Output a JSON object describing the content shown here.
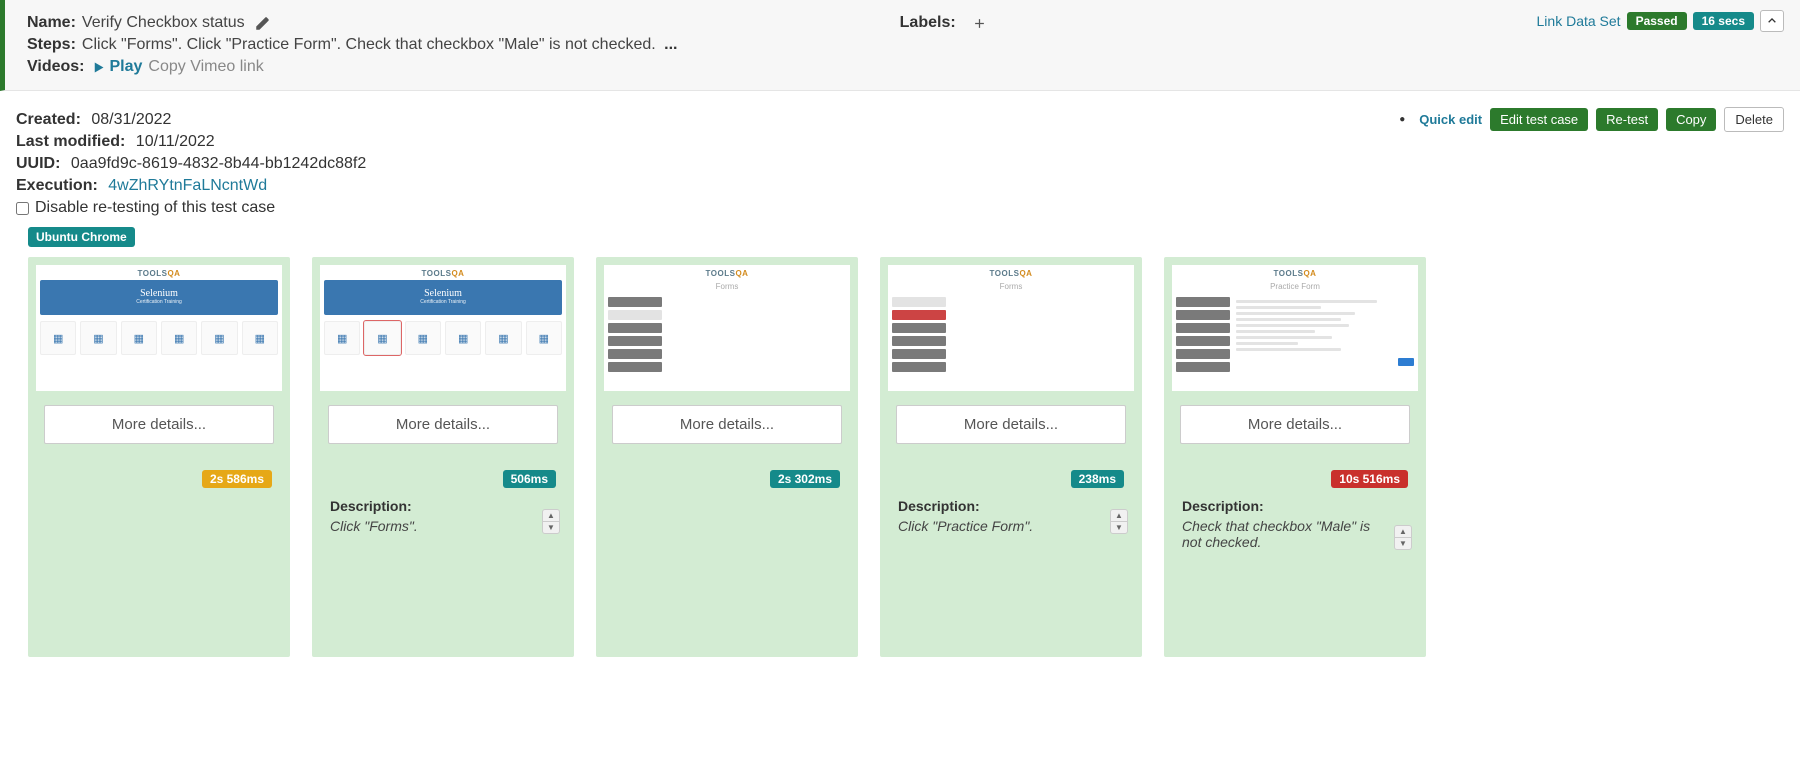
{
  "header": {
    "name_label": "Name:",
    "name_value": "Verify Checkbox status",
    "labels_label": "Labels:",
    "steps_label": "Steps:",
    "steps_value": "Click \"Forms\". Click \"Practice Form\". Check that checkbox \"Male\" is not checked.",
    "videos_label": "Videos:",
    "play_label": "Play",
    "copy_vimeo_label": "Copy Vimeo link",
    "link_dataset": "Link Data Set",
    "status_badge": "Passed",
    "duration_badge": "16 secs"
  },
  "meta": {
    "created_label": "Created:",
    "created_value": "08/31/2022",
    "modified_label": "Last modified:",
    "modified_value": "10/11/2022",
    "uuid_label": "UUID:",
    "uuid_value": "0aa9fd9c-8619-4832-8b44-bb1242dc88f2",
    "execution_label": "Execution:",
    "execution_value": "4wZhRYtnFaLNcntWd",
    "disable_label": "Disable re-testing of this test case",
    "quick_edit": "Quick edit",
    "edit_btn": "Edit test case",
    "retest_btn": "Re-test",
    "copy_btn": "Copy",
    "delete_btn": "Delete"
  },
  "env_tag": "Ubuntu Chrome",
  "cards": [
    {
      "more": "More details...",
      "time": "2s 586ms",
      "time_class": "t-orange",
      "desc_label": "",
      "desc_text": "",
      "thumb": "home"
    },
    {
      "more": "More details...",
      "time": "506ms",
      "time_class": "t-teal",
      "desc_label": "Description:",
      "desc_text": "Click \"Forms\".",
      "thumb": "home-sel"
    },
    {
      "more": "More details...",
      "time": "2s 302ms",
      "time_class": "t-teal",
      "desc_label": "",
      "desc_text": "",
      "thumb": "forms-a"
    },
    {
      "more": "More details...",
      "time": "238ms",
      "time_class": "t-teal",
      "desc_label": "Description:",
      "desc_text": "Click \"Practice Form\".",
      "thumb": "forms-b"
    },
    {
      "more": "More details...",
      "time": "10s 516ms",
      "time_class": "t-red",
      "desc_label": "Description:",
      "desc_text": "Check that checkbox \"Male\" is not checked.",
      "thumb": "practice"
    }
  ]
}
